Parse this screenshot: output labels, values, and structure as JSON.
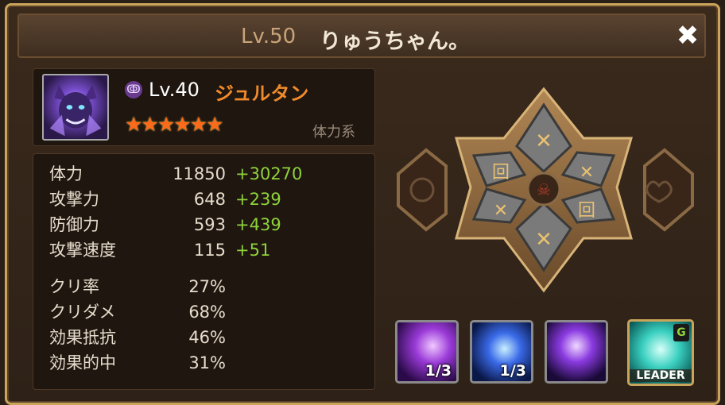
{
  "header": {
    "level": "Lv.50",
    "player_name": "りゅうちゃん。",
    "close_symbol": "✖"
  },
  "monster": {
    "element_icon": "dark-element-icon",
    "level": "Lv.40",
    "name": "ジュルタン",
    "stars": 6,
    "stars_text": "★★★★★★",
    "type": "体力系"
  },
  "stats": [
    {
      "label": "体力",
      "base": "11850",
      "bonus": "+30270"
    },
    {
      "label": "攻撃力",
      "base": "648",
      "bonus": "+239"
    },
    {
      "label": "防御力",
      "base": "593",
      "bonus": "+439"
    },
    {
      "label": "攻撃速度",
      "base": "115",
      "bonus": "+51"
    },
    {
      "label": "クリ率",
      "base": "27%",
      "bonus": ""
    },
    {
      "label": "クリダメ",
      "base": "68%",
      "bonus": ""
    },
    {
      "label": "効果抵抗",
      "base": "46%",
      "bonus": ""
    },
    {
      "label": "効果的中",
      "base": "31%",
      "bonus": ""
    }
  ],
  "skills": [
    {
      "icon": "dark-wolf-skill-icon",
      "count": "1/3"
    },
    {
      "icon": "wind-wolf-skill-icon",
      "count": "1/3"
    },
    {
      "icon": "dark-flame-skill-icon",
      "count": ""
    }
  ],
  "leader": {
    "label": "LEADER",
    "badge": "G"
  },
  "colors": {
    "frame_gold": "#c9a45a",
    "name_orange": "#f08a2a",
    "bonus_green": "#8fd33a",
    "panel_bg": "#1f1610"
  }
}
